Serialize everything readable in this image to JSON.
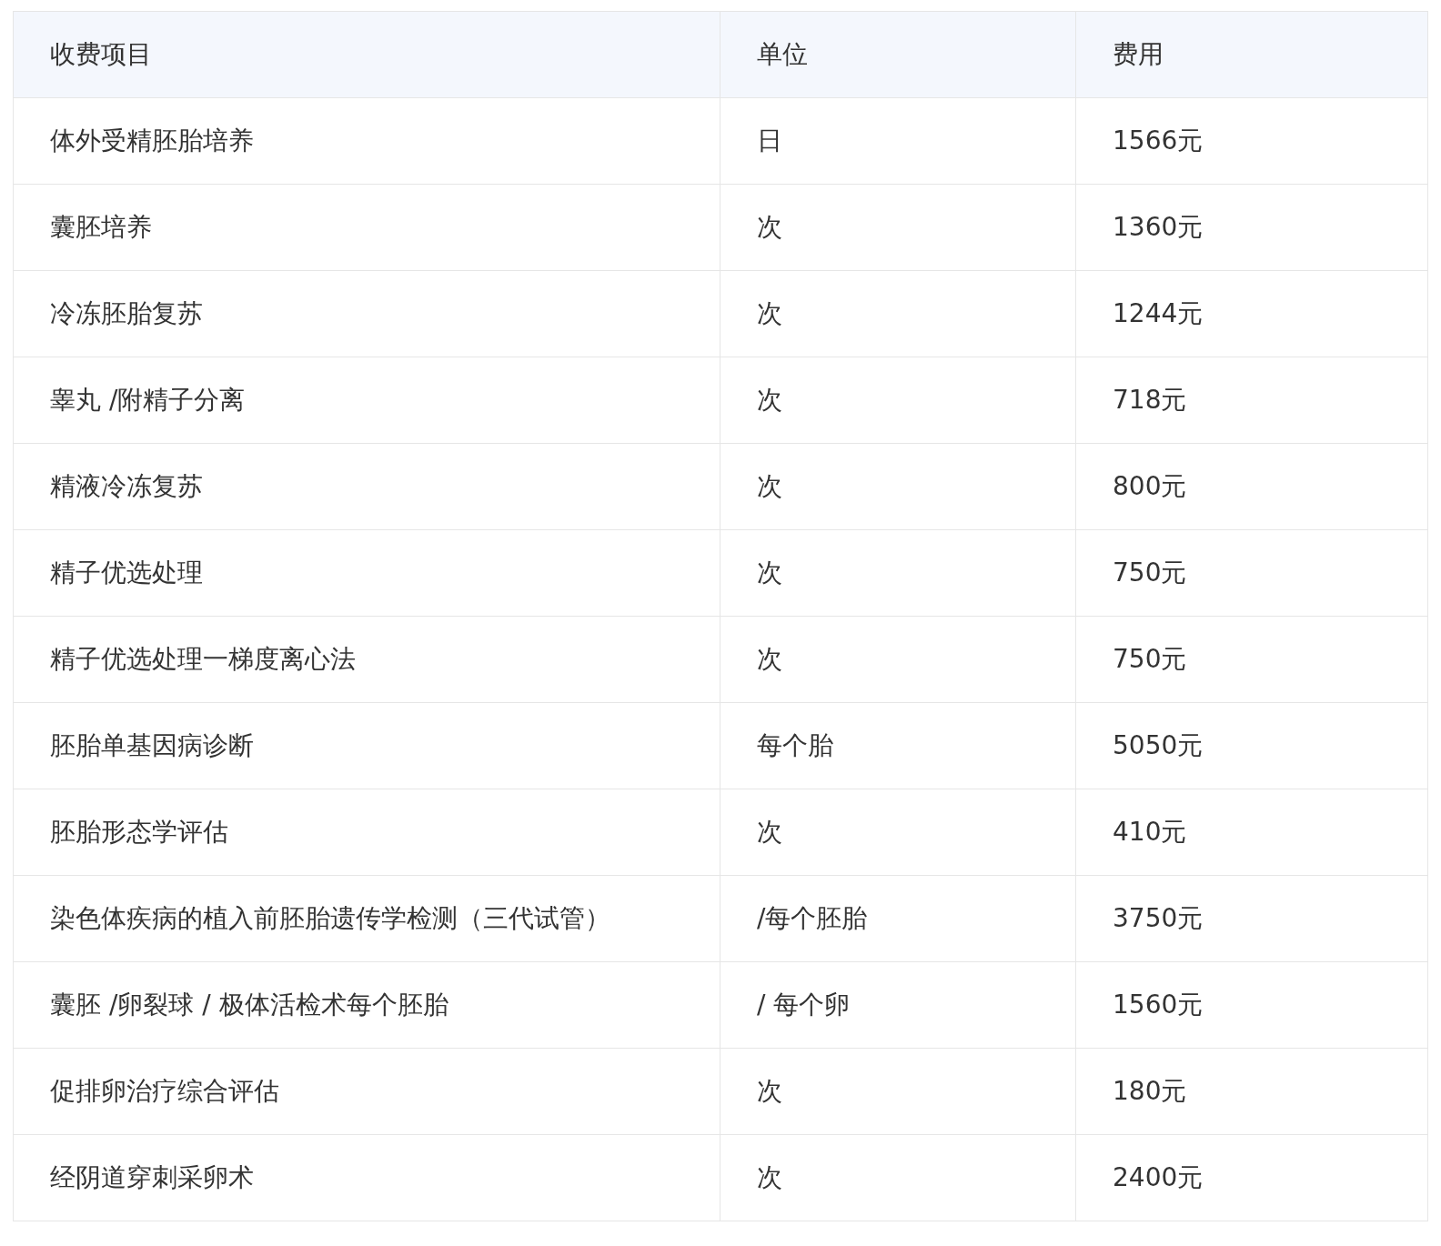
{
  "table": {
    "columns": [
      "收费项目",
      "单位",
      "费用"
    ],
    "rows": [
      [
        "体外受精胚胎培养",
        "日",
        "1566元"
      ],
      [
        "囊胚培养",
        "次",
        "1360元"
      ],
      [
        "冷冻胚胎复苏",
        "次",
        "1244元"
      ],
      [
        "睾丸 /附精子分离",
        "次",
        "718元"
      ],
      [
        "精液冷冻复苏",
        "次",
        "800元"
      ],
      [
        "精子优选处理",
        "次",
        "750元"
      ],
      [
        "精子优选处理一梯度离心法",
        "次",
        "750元"
      ],
      [
        "胚胎单基因病诊断",
        "每个胎",
        "5050元"
      ],
      [
        "胚胎形态学评估",
        "次",
        "410元"
      ],
      [
        "染色体疾病的植入前胚胎遗传学检测（三代试管）",
        "/每个胚胎",
        "3750元"
      ],
      [
        "囊胚 /卵裂球 / 极体活检术每个胚胎",
        "/ 每个卵",
        "1560元"
      ],
      [
        "促排卵治疗综合评估",
        "次",
        "180元"
      ],
      [
        "经阴道穿刺采卵术",
        "次",
        "2400元"
      ]
    ]
  }
}
